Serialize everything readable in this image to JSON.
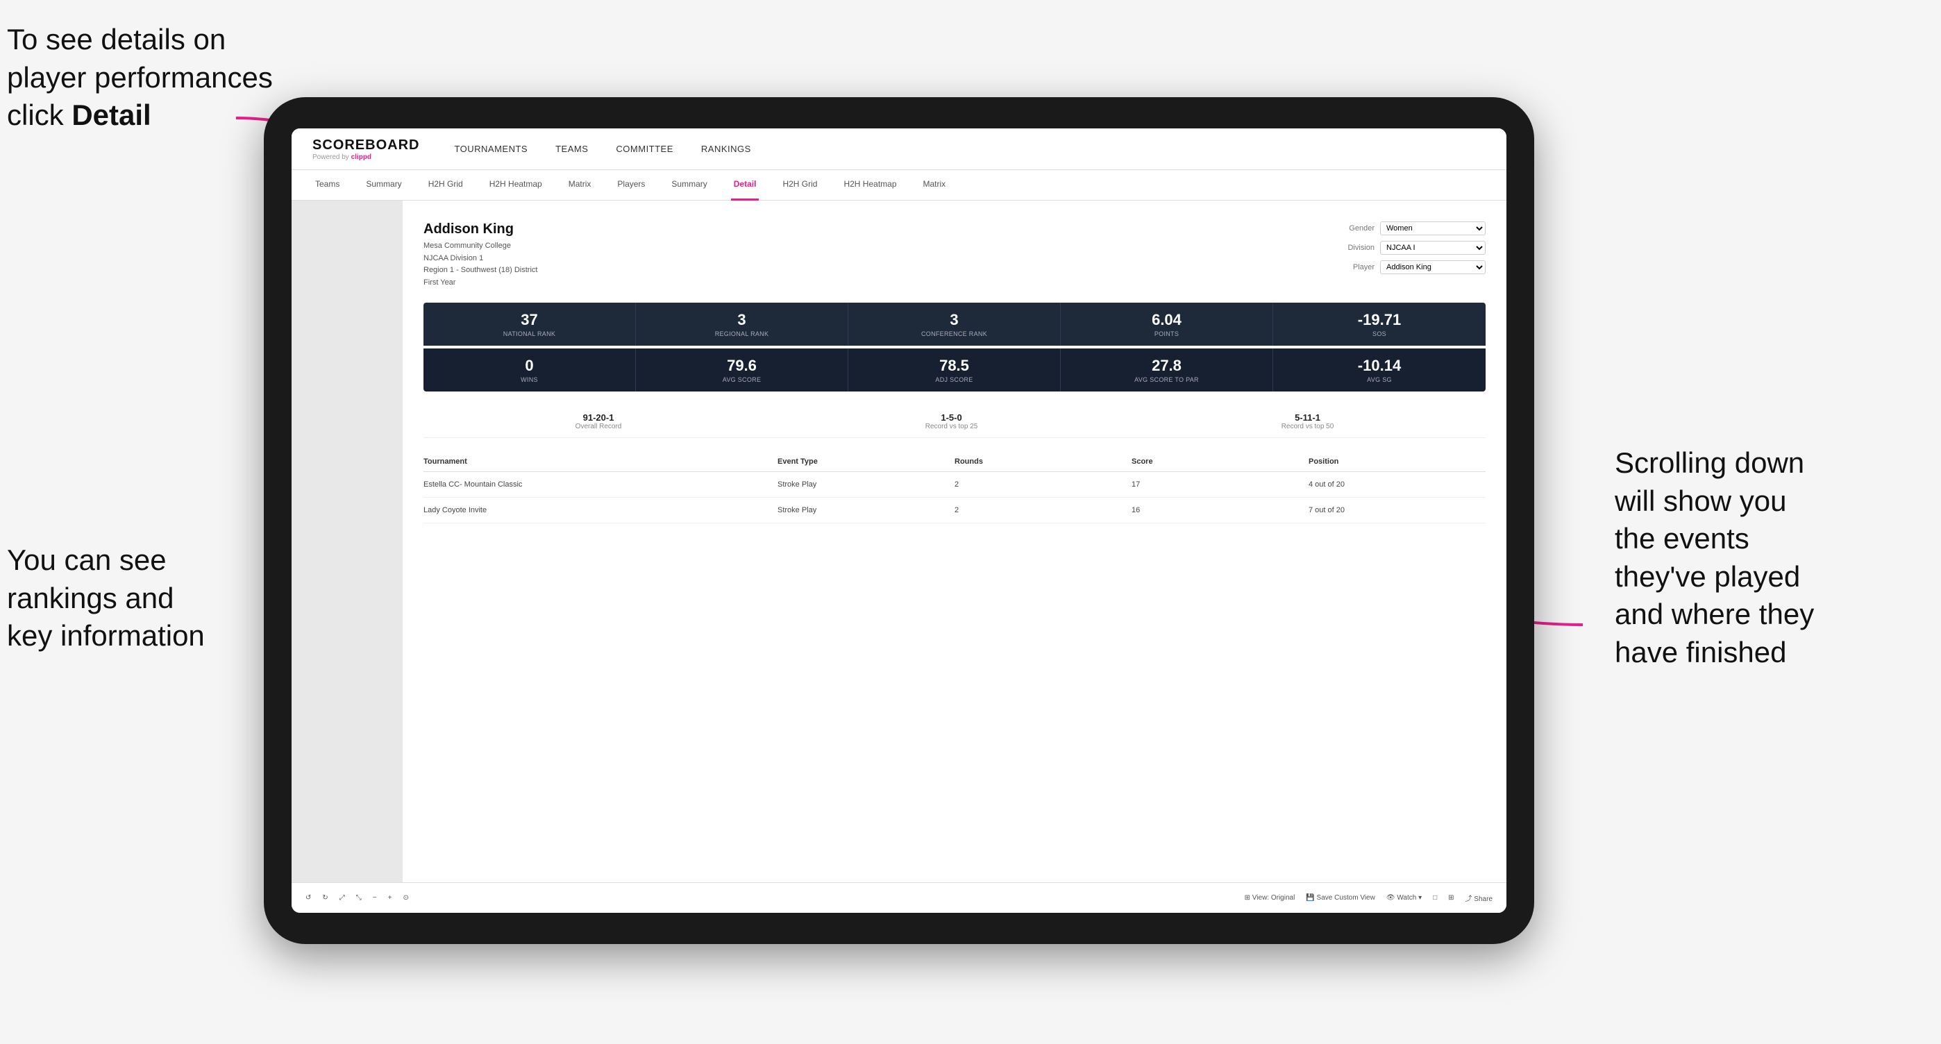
{
  "annotations": {
    "top_left": "To see details on player performances click ",
    "top_left_bold": "Detail",
    "bottom_left_line1": "You can see",
    "bottom_left_line2": "rankings and",
    "bottom_left_line3": "key information",
    "right_line1": "Scrolling down",
    "right_line2": "will show you",
    "right_line3": "the events",
    "right_line4": "they've played",
    "right_line5": "and where they",
    "right_line6": "have finished"
  },
  "nav": {
    "logo": "SCOREBOARD",
    "powered_by": "Powered by ",
    "powered_brand": "clippd",
    "main_items": [
      "TOURNAMENTS",
      "TEAMS",
      "COMMITTEE",
      "RANKINGS"
    ],
    "sub_items": [
      "Teams",
      "Summary",
      "H2H Grid",
      "H2H Heatmap",
      "Matrix",
      "Players",
      "Summary",
      "Detail",
      "H2H Grid",
      "H2H Heatmap",
      "Matrix"
    ]
  },
  "player": {
    "name": "Addison King",
    "college": "Mesa Community College",
    "division": "NJCAA Division 1",
    "region": "Region 1 - Southwest (18) District",
    "year": "First Year"
  },
  "controls": {
    "gender_label": "Gender",
    "gender_value": "Women",
    "division_label": "Division",
    "division_value": "NJCAA I",
    "player_label": "Player",
    "player_value": "Addison King"
  },
  "stats_row1": [
    {
      "value": "37",
      "label": "National Rank"
    },
    {
      "value": "3",
      "label": "Regional Rank"
    },
    {
      "value": "3",
      "label": "Conference Rank"
    },
    {
      "value": "6.04",
      "label": "Points"
    },
    {
      "value": "-19.71",
      "label": "SoS"
    }
  ],
  "stats_row2": [
    {
      "value": "0",
      "label": "Wins"
    },
    {
      "value": "79.6",
      "label": "Avg Score"
    },
    {
      "value": "78.5",
      "label": "Adj Score"
    },
    {
      "value": "27.8",
      "label": "Avg Score to Par"
    },
    {
      "value": "-10.14",
      "label": "Avg SG"
    }
  ],
  "records": [
    {
      "value": "91-20-1",
      "label": "Overall Record"
    },
    {
      "value": "1-5-0",
      "label": "Record vs top 25"
    },
    {
      "value": "5-11-1",
      "label": "Record vs top 50"
    }
  ],
  "table": {
    "headers": [
      "Tournament",
      "Event Type",
      "Rounds",
      "Score",
      "Position"
    ],
    "rows": [
      {
        "tournament": "Estella CC- Mountain Classic",
        "event_type": "Stroke Play",
        "rounds": "2",
        "score": "17",
        "position": "4 out of 20"
      },
      {
        "tournament": "Lady Coyote Invite",
        "event_type": "Stroke Play",
        "rounds": "2",
        "score": "16",
        "position": "7 out of 20"
      }
    ]
  },
  "toolbar": {
    "buttons": [
      "↺",
      "↻",
      "⤢",
      "⤡",
      "−",
      "+",
      "⊙",
      "View: Original",
      "Save Custom View",
      "Watch ▾",
      "□",
      "⊞",
      "Share"
    ]
  }
}
